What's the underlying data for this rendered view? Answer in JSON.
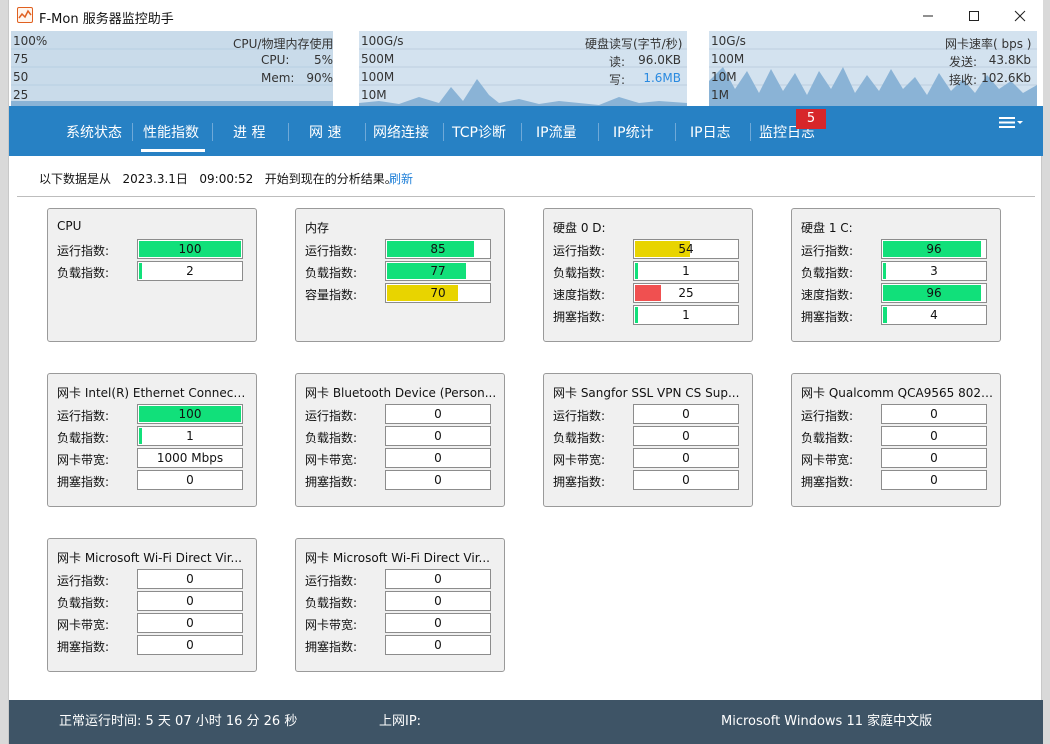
{
  "window": {
    "title": "F-Mon 服务器监控助手"
  },
  "monitor": {
    "cpu_panel": {
      "title": "CPU/物理内存使用",
      "scale": [
        "100%",
        "75",
        "50",
        "25"
      ],
      "cpu_label": "CPU:",
      "cpu_value": "5%",
      "mem_label": "Mem:",
      "mem_value": "90%"
    },
    "disk_panel": {
      "title": "硬盘读写(字节/秒)",
      "scale": [
        "100G/s",
        "500M",
        "100M",
        "10M"
      ],
      "read_label": "读:",
      "read_value": "96.0KB",
      "write_label": "写:",
      "write_value": "1.6MB"
    },
    "net_panel": {
      "title": "网卡速率( bps )",
      "scale": [
        "10G/s",
        "100M",
        "10M",
        "1M"
      ],
      "send_label": "发送:",
      "send_value": "43.8Kb",
      "recv_label": "接收:",
      "recv_value": "102.6Kb"
    }
  },
  "nav": {
    "items": [
      "系统状态",
      "性能指数",
      "进 程",
      "网 速",
      "网络连接",
      "TCP诊断",
      "IP流量",
      "IP统计",
      "IP日志",
      "监控日志"
    ],
    "active": "性能指数",
    "badge": "5"
  },
  "info": {
    "prefix": "以下数据是从",
    "date": "2023.3.1日",
    "time": "09:00:52",
    "suffix": "开始到现在的分析结果。",
    "refresh": "刷新"
  },
  "colors": {
    "green": "#11e07a",
    "yellow": "#e8d400",
    "red": "#f05050",
    "nav_bg": "#2781c4",
    "status_bg": "#3e5466"
  },
  "cards": [
    {
      "title": "CPU",
      "rows": [
        {
          "label": "运行指数:",
          "value": "100",
          "percent": 100,
          "color": "green"
        },
        {
          "label": "负载指数:",
          "value": "2",
          "percent": 2,
          "color": "green"
        }
      ]
    },
    {
      "title": "内存",
      "rows": [
        {
          "label": "运行指数:",
          "value": "85",
          "percent": 85,
          "color": "green"
        },
        {
          "label": "负载指数:",
          "value": "77",
          "percent": 77,
          "color": "green"
        },
        {
          "label": "容量指数:",
          "value": "70",
          "percent": 70,
          "color": "yellow"
        }
      ]
    },
    {
      "title": "硬盘 0 D:",
      "rows": [
        {
          "label": "运行指数:",
          "value": "54",
          "percent": 54,
          "color": "yellow"
        },
        {
          "label": "负载指数:",
          "value": "1",
          "percent": 1,
          "color": "green"
        },
        {
          "label": "速度指数:",
          "value": "25",
          "percent": 25,
          "color": "red"
        },
        {
          "label": "拥塞指数:",
          "value": "1",
          "percent": 1,
          "color": "green"
        }
      ]
    },
    {
      "title": "硬盘 1 C:",
      "rows": [
        {
          "label": "运行指数:",
          "value": "96",
          "percent": 96,
          "color": "green"
        },
        {
          "label": "负载指数:",
          "value": "3",
          "percent": 3,
          "color": "green"
        },
        {
          "label": "速度指数:",
          "value": "96",
          "percent": 96,
          "color": "green"
        },
        {
          "label": "拥塞指数:",
          "value": "4",
          "percent": 4,
          "color": "green"
        }
      ]
    },
    {
      "title": "网卡 Intel(R) Ethernet Connecti...",
      "rows": [
        {
          "label": "运行指数:",
          "value": "100",
          "percent": 100,
          "color": "green"
        },
        {
          "label": "负载指数:",
          "value": "1",
          "percent": 1,
          "color": "green"
        },
        {
          "label": "网卡带宽:",
          "value": "1000 Mbps",
          "percent": 0,
          "color": "green"
        },
        {
          "label": "拥塞指数:",
          "value": "0",
          "percent": 0,
          "color": "green"
        }
      ]
    },
    {
      "title": "网卡 Bluetooth Device (Person...",
      "rows": [
        {
          "label": "运行指数:",
          "value": "0",
          "percent": 0,
          "color": "green"
        },
        {
          "label": "负载指数:",
          "value": "0",
          "percent": 0,
          "color": "green"
        },
        {
          "label": "网卡带宽:",
          "value": "0",
          "percent": 0,
          "color": "green"
        },
        {
          "label": "拥塞指数:",
          "value": "0",
          "percent": 0,
          "color": "green"
        }
      ]
    },
    {
      "title": "网卡 Sangfor SSL VPN CS Sup...",
      "rows": [
        {
          "label": "运行指数:",
          "value": "0",
          "percent": 0,
          "color": "green"
        },
        {
          "label": "负载指数:",
          "value": "0",
          "percent": 0,
          "color": "green"
        },
        {
          "label": "网卡带宽:",
          "value": "0",
          "percent": 0,
          "color": "green"
        },
        {
          "label": "拥塞指数:",
          "value": "0",
          "percent": 0,
          "color": "green"
        }
      ]
    },
    {
      "title": "网卡 Qualcomm QCA9565 802....",
      "rows": [
        {
          "label": "运行指数:",
          "value": "0",
          "percent": 0,
          "color": "green"
        },
        {
          "label": "负载指数:",
          "value": "0",
          "percent": 0,
          "color": "green"
        },
        {
          "label": "网卡带宽:",
          "value": "0",
          "percent": 0,
          "color": "green"
        },
        {
          "label": "拥塞指数:",
          "value": "0",
          "percent": 0,
          "color": "green"
        }
      ]
    },
    {
      "title": "网卡 Microsoft Wi-Fi Direct Vir...",
      "rows": [
        {
          "label": "运行指数:",
          "value": "0",
          "percent": 0,
          "color": "green"
        },
        {
          "label": "负载指数:",
          "value": "0",
          "percent": 0,
          "color": "green"
        },
        {
          "label": "网卡带宽:",
          "value": "0",
          "percent": 0,
          "color": "green"
        },
        {
          "label": "拥塞指数:",
          "value": "0",
          "percent": 0,
          "color": "green"
        }
      ]
    },
    {
      "title": "网卡 Microsoft Wi-Fi Direct Vir...",
      "rows": [
        {
          "label": "运行指数:",
          "value": "0",
          "percent": 0,
          "color": "green"
        },
        {
          "label": "负载指数:",
          "value": "0",
          "percent": 0,
          "color": "green"
        },
        {
          "label": "网卡带宽:",
          "value": "0",
          "percent": 0,
          "color": "green"
        },
        {
          "label": "拥塞指数:",
          "value": "0",
          "percent": 0,
          "color": "green"
        }
      ]
    }
  ],
  "status": {
    "uptime": "正常运行时间:   5  天  07 小时 16 分 26 秒",
    "ip_label": "上网IP:",
    "os": "Microsoft Windows 11 家庭中文版"
  }
}
